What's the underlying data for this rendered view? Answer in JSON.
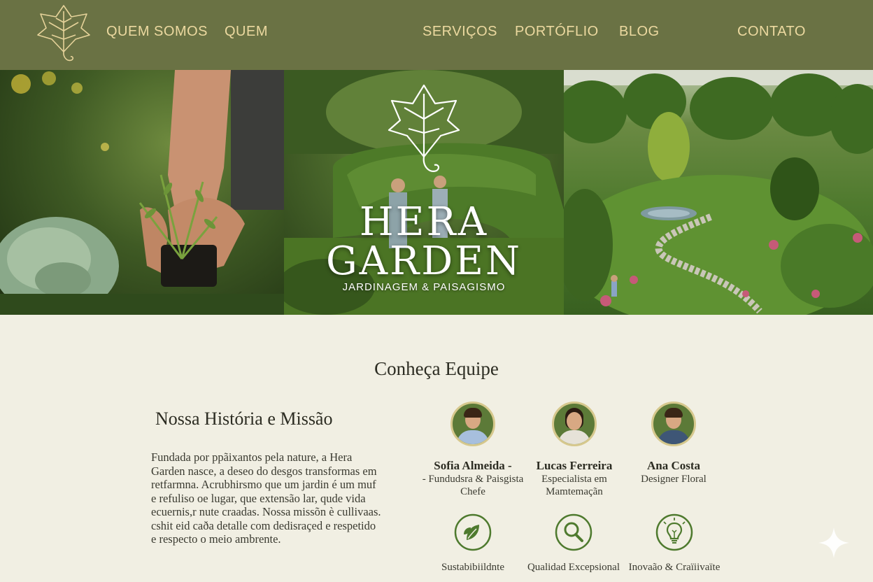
{
  "nav": {
    "links": [
      "QUEM SOMOS",
      "QUEM",
      "SERVIÇOS",
      "PORTÓFLIO",
      "BLOG",
      "CONTATO"
    ]
  },
  "hero": {
    "brand_line1": "HERA",
    "brand_line2": "GARDEN",
    "tagline": "JARDINAGEM & PAISAGISMO"
  },
  "team": {
    "heading": "Conheça Equipe",
    "members": [
      {
        "name": "Sofia Almeida -",
        "role": "- Fundudsra & Paisgista Chefe"
      },
      {
        "name": "Lucas Ferreira",
        "role": "Especialista em Mamtemaçãn"
      },
      {
        "name": "Ana Costa",
        "role": "Designer Floral"
      }
    ]
  },
  "history": {
    "heading": "Nossa História e Missão",
    "text": "Fundada por ppãixantos pela nature, a Hera Garden nasce, a deseo do desgos transformas em retfarmna. Acrubhirsmo que um jardin é um muf e refuliso oe lugar, que extensão lar, qude vida ecuernis,r nute craadas. Nossa missõn è cullivaas. cshit eid caða detalle com dedisraçed e respetido e respecto o meio ambrente."
  },
  "values": [
    {
      "icon": "leaf-icon",
      "label": "Sustabibiildnte"
    },
    {
      "icon": "magnifier-icon",
      "label": "Qualidad Excepsional"
    },
    {
      "icon": "lightbulb-icon",
      "label": "Inovaão & Craïiivaïte"
    }
  ],
  "colors": {
    "nav_bg": "#6a7244",
    "nav_text": "#ecd9a0",
    "page_bg": "#f1efe3",
    "icon_green": "#4e7a2e"
  }
}
